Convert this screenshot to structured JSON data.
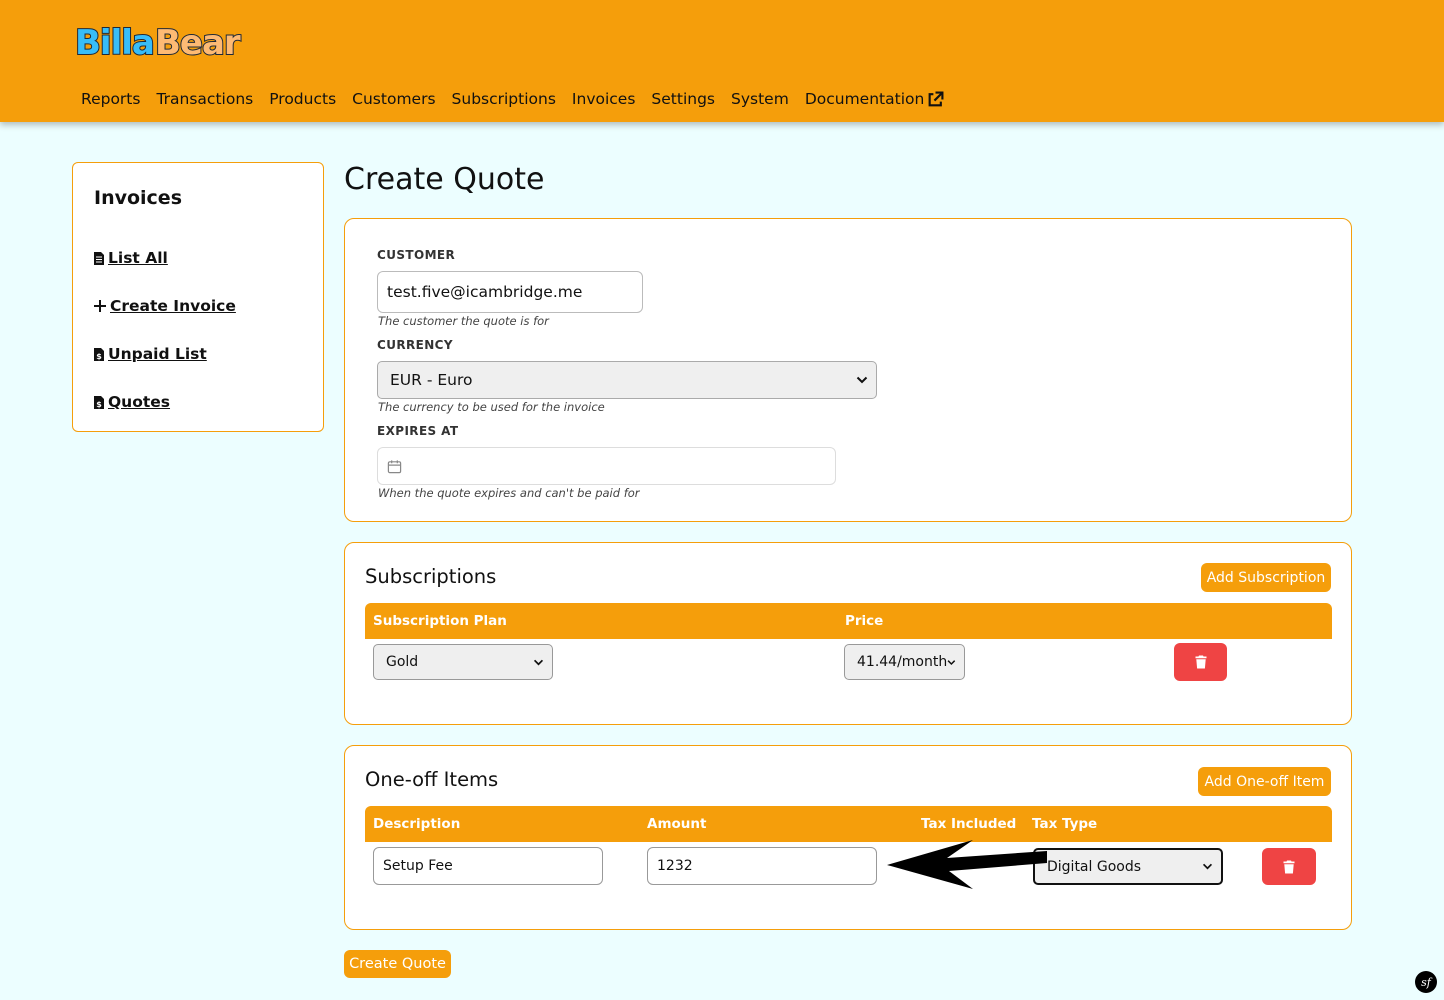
{
  "brand": {
    "logo_text": "BillaBear"
  },
  "nav": {
    "items": [
      "Reports",
      "Transactions",
      "Products",
      "Customers",
      "Subscriptions",
      "Invoices",
      "Settings",
      "System",
      "Documentation"
    ]
  },
  "sidebar": {
    "title": "Invoices",
    "links": [
      "List All",
      "Create Invoice",
      "Unpaid List",
      "Quotes"
    ]
  },
  "page": {
    "title": "Create Quote"
  },
  "form": {
    "customer_label": "CUSTOMER",
    "customer_value": "test.five@icambridge.me",
    "customer_help": "The customer the quote is for",
    "currency_label": "CURRENCY",
    "currency_value": "EUR - Euro",
    "currency_help": "The currency to be used for the invoice",
    "expires_label": "EXPIRES AT",
    "expires_value": "",
    "expires_help": "When the quote expires and can't be paid for"
  },
  "subscriptions": {
    "title": "Subscriptions",
    "add_label": "Add Subscription",
    "headers": [
      "Subscription Plan",
      "Price"
    ],
    "rows": [
      {
        "plan": "Gold",
        "price": "41.44/month"
      }
    ]
  },
  "oneoff": {
    "title": "One-off Items",
    "add_label": "Add One-off Item",
    "headers": [
      "Description",
      "Amount",
      "Tax Included",
      "Tax Type"
    ],
    "rows": [
      {
        "description": "Setup Fee",
        "amount": "1232",
        "tax_type": "Digital Goods"
      }
    ]
  },
  "submit_label": "Create Quote",
  "colors": {
    "primary": "#f59e0b",
    "danger": "#ef4444",
    "background": "#ecfeff"
  }
}
